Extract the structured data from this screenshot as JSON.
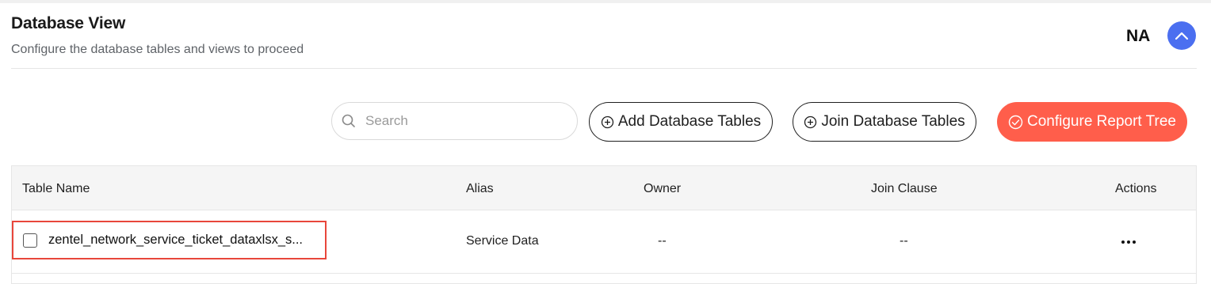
{
  "header": {
    "title": "Database View",
    "subtitle": "Configure the database tables and views to proceed",
    "status_label": "NA",
    "collapse_icon": "chevron-up-icon"
  },
  "toolbar": {
    "search": {
      "placeholder": "Search",
      "value": ""
    },
    "add_button_label": "Add Database Tables",
    "join_button_label": "Join Database Tables",
    "configure_button_label": "Configure Report Tree"
  },
  "table": {
    "columns": [
      "Table Name",
      "Alias",
      "Owner",
      "Join Clause",
      "Actions"
    ],
    "rows": [
      {
        "table_name": "zentel_network_service_ticket_dataxlsx_s...",
        "alias": "Service Data",
        "owner": "--",
        "join_clause": "--",
        "actions_icon": "more-horizontal-icon"
      }
    ]
  },
  "colors": {
    "accent_blue": "#4b6ff0",
    "primary_action": "#ff5e4b",
    "highlight_border": "#e8463b"
  }
}
